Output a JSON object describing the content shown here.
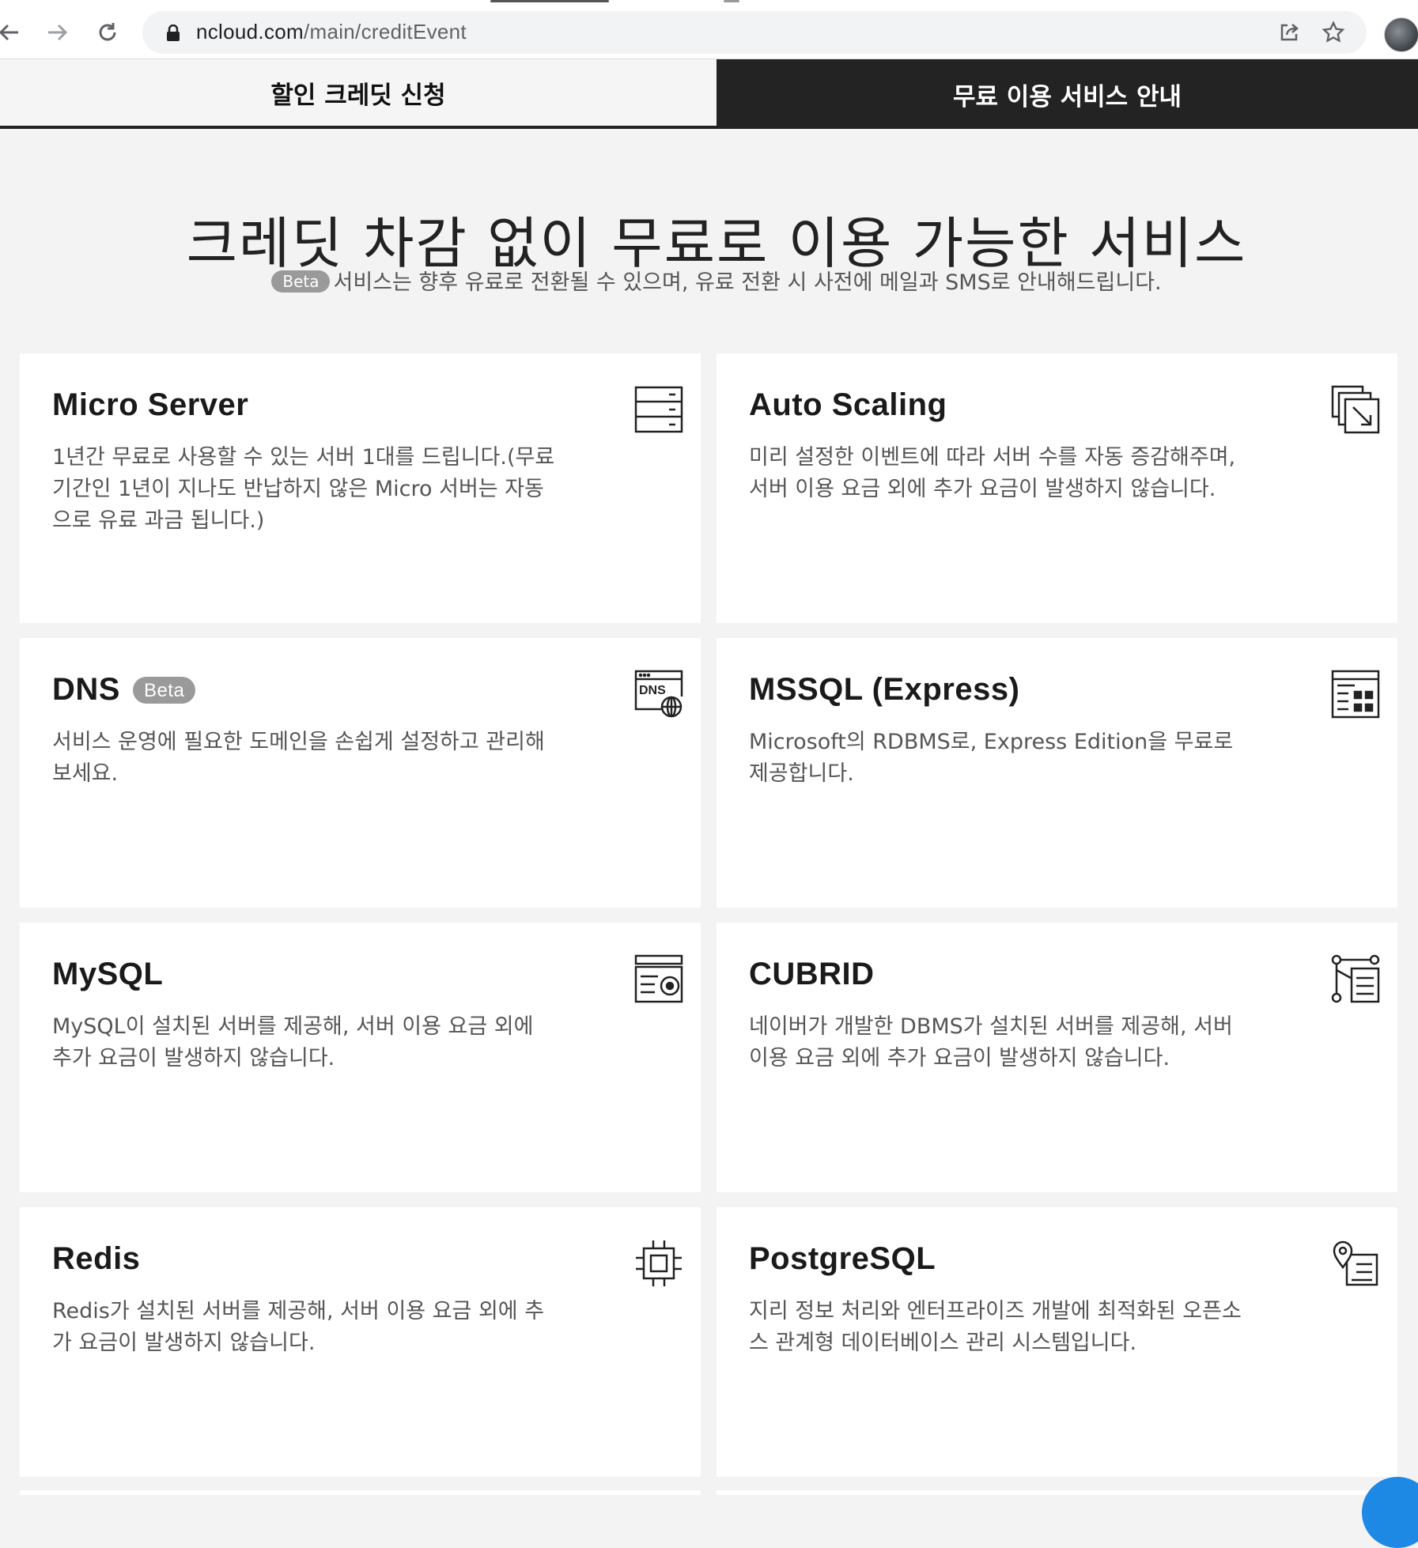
{
  "browser": {
    "url_domain": "ncloud.com",
    "url_path": "/main/creditEvent"
  },
  "tabs": [
    {
      "label": "할인 크레딧 신청",
      "active": false
    },
    {
      "label": "무료 이용 서비스 안내",
      "active": true
    }
  ],
  "heading": {
    "title": "크레딧 차감 없이 무료로 이용 가능한 서비스",
    "badge": "Beta",
    "notice": "서비스는 향후 유료로 전환될 수 있으며, 유료 전환 시 사전에 메일과 SMS로 안내해드립니다."
  },
  "cards": [
    {
      "title": "Micro Server",
      "desc": "1년간 무료로 사용할 수 있는 서버 1대를 드립니다.(무료 기간인 1년이 지나도 반납하지 않은 Micro 서버는 자동으로 유료 과금 됩니다.)",
      "icon": "server-icon"
    },
    {
      "title": "Auto Scaling",
      "desc": "미리 설정한 이벤트에 따라 서버 수를 자동 증감해주며, 서버 이용 요금 외에 추가 요금이 발생하지 않습니다.",
      "icon": "autoscaling-icon"
    },
    {
      "title": "DNS",
      "tag": "Beta",
      "desc": "서비스 운영에 필요한 도메인을 손쉽게 설정하고 관리해보세요.",
      "icon": "dns-icon"
    },
    {
      "title": "MSSQL (Express)",
      "desc": "Microsoft의 RDBMS로, Express Edition을 무료로 제공합니다.",
      "icon": "mssql-icon"
    },
    {
      "title": "MySQL",
      "desc": "MySQL이 설치된 서버를 제공해, 서버 이용 요금 외에 추가 요금이 발생하지 않습니다.",
      "icon": "mysql-icon"
    },
    {
      "title": "CUBRID",
      "desc": "네이버가 개발한 DBMS가 설치된 서버를 제공해, 서버 이용 요금 외에 추가 요금이 발생하지 않습니다.",
      "icon": "cubrid-icon"
    },
    {
      "title": "Redis",
      "desc": "Redis가 설치된 서버를 제공해, 서버 이용 요금 외에 추가 요금이 발생하지 않습니다.",
      "icon": "chip-icon"
    },
    {
      "title": "PostgreSQL",
      "desc": "지리 정보 처리와 엔터프라이즈 개발에 최적화된 오픈소스 관계형 데이터베이스 관리 시스템입니다.",
      "icon": "postgresql-icon"
    }
  ]
}
